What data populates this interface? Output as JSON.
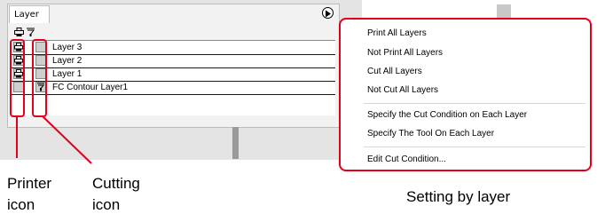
{
  "panel": {
    "tab_label": "Layer",
    "header_icons": [
      "printer-icon",
      "cutter-icon"
    ],
    "menu_button_icon": "play-circle-icon"
  },
  "layers": [
    {
      "name": "Layer 3",
      "print": true,
      "cut": false
    },
    {
      "name": "Layer 2",
      "print": true,
      "cut": false
    },
    {
      "name": "Layer 1",
      "print": true,
      "cut": false
    },
    {
      "name": "FC Contour Layer1",
      "print": false,
      "cut": true
    }
  ],
  "menu": {
    "group1": [
      "Print All Layers",
      "Not Print All Layers",
      "Cut All Layers",
      "Not Cut All Layers"
    ],
    "group2": [
      "Specify the Cut Condition on Each Layer",
      "Specify The Tool On Each Layer"
    ],
    "group3": [
      "Edit Cut Condition..."
    ]
  },
  "callouts": {
    "printer_line1": "Printer",
    "printer_line2": "icon",
    "cutting_line1": "Cutting",
    "cutting_line2": "icon",
    "setting_by_layer": "Setting by layer"
  },
  "colors": {
    "highlight": "#e3001b"
  }
}
